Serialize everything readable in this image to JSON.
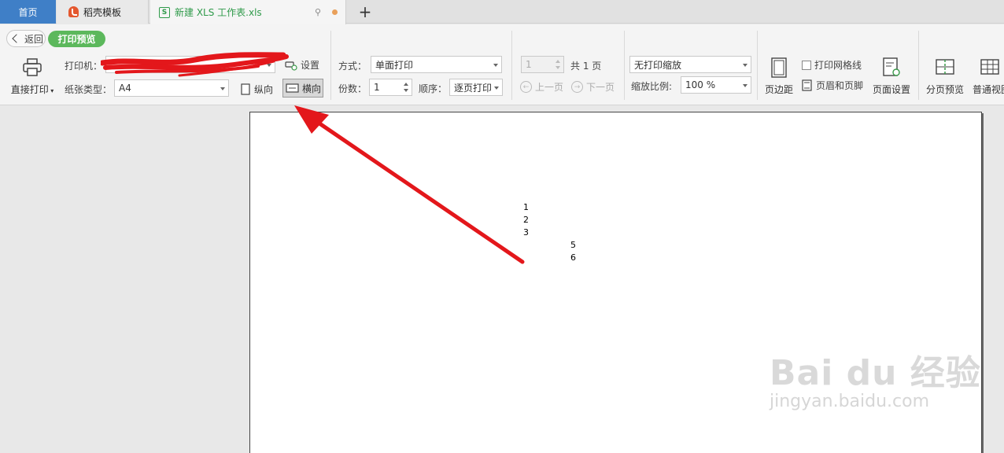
{
  "tabs": {
    "home": "首页",
    "template": "稻壳模板",
    "document": "新建 XLS 工作表.xls"
  },
  "toolbar": {
    "back": "返回",
    "mode_badge": "打印预览",
    "direct_print": "直接打印",
    "printer_label": "打印机：",
    "settings": "设置",
    "paper_type_label": "纸张类型：",
    "paper_type_value": "A4",
    "portrait": "纵向",
    "landscape": "横向",
    "mode_label": "方式：",
    "mode_value": "单面打印",
    "copies_label": "份数：",
    "copies_value": "1",
    "order_label": "顺序：",
    "order_value": "逐页打印",
    "page_value": "1",
    "total_pages": "共 1 页",
    "prev_page": "上一页",
    "next_page": "下一页",
    "scale_select": "无打印缩放",
    "zoom_label": "缩放比例:",
    "zoom_value": "100 %",
    "margins": "页边距",
    "print_gridlines": "打印网格线",
    "header_footer": "页眉和页脚",
    "page_setup": "页面设置",
    "page_break_preview": "分页预览",
    "normal_view": "普通视图"
  },
  "sheet": {
    "cells": [
      "1",
      "2",
      "3",
      "5",
      "6"
    ]
  },
  "watermark": {
    "brand": "Bai du 经验",
    "url": "jingyan.baidu.com"
  },
  "colors": {
    "home_tab": "#3f7fc7",
    "badge": "#5cb85c",
    "doc_tab_text": "#2f9a4a",
    "annotation": "#e3171b"
  }
}
